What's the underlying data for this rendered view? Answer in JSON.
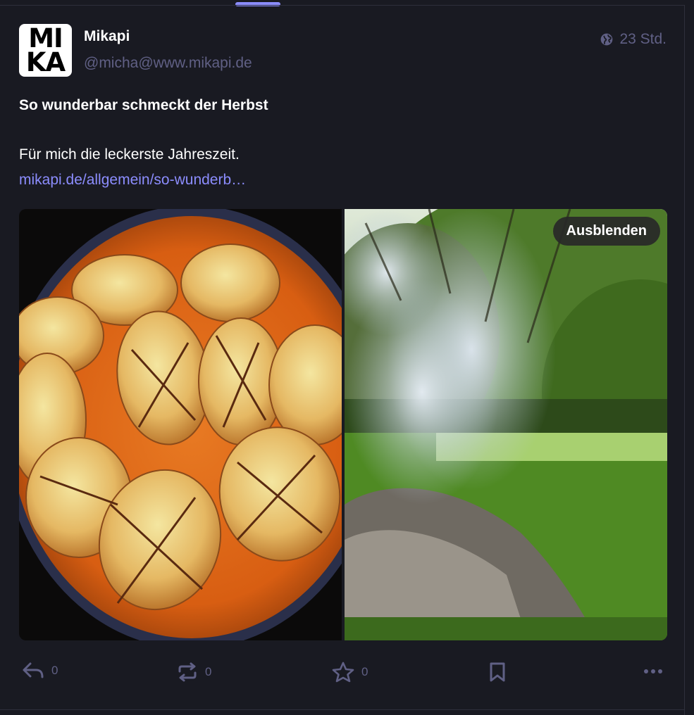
{
  "post": {
    "account": {
      "display_name": "Mikapi",
      "handle": "@micha@www.mikapi.de",
      "avatar_line1": "MI",
      "avatar_line2": "KA"
    },
    "visibility_icon": "globe-icon",
    "timestamp": "23 Std.",
    "title": "So wunderbar schmeckt der Herbst",
    "body": "Für mich die leckerste Jahreszeit.",
    "link_text": "mikapi.de/allgemein/so-wunderb…",
    "media": {
      "hide_label": "Ausblenden",
      "items": [
        "stuffed-cabbage-photo",
        "forest-smoke-photo"
      ]
    },
    "actions": {
      "reply_count": "0",
      "boost_count": "0",
      "favourite_count": "0"
    }
  },
  "colors": {
    "background": "#191a22",
    "accent": "#8c8dff",
    "muted": "#606085"
  }
}
